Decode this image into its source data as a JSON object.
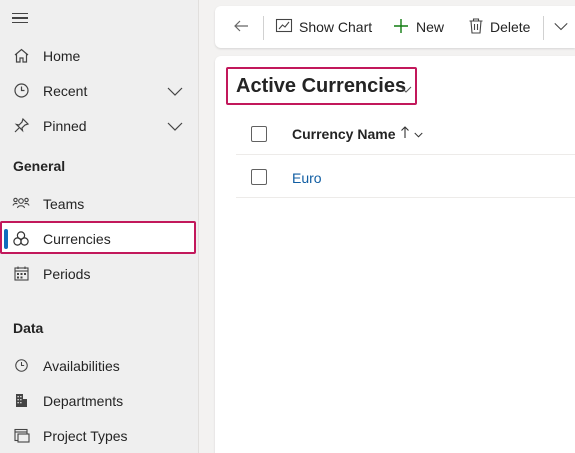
{
  "sidebar": {
    "menu_icon": "hamburger-icon",
    "items": [
      {
        "label": "Home",
        "icon": "home-icon"
      },
      {
        "label": "Recent",
        "icon": "clock-icon"
      },
      {
        "label": "Pinned",
        "icon": "pin-icon"
      }
    ],
    "sections": [
      {
        "title": "General",
        "items": [
          {
            "label": "Teams",
            "icon": "people-icon"
          },
          {
            "label": "Currencies",
            "icon": "currency-icon",
            "selected": true
          },
          {
            "label": "Periods",
            "icon": "calendar-icon"
          }
        ]
      },
      {
        "title": "Data",
        "items": [
          {
            "label": "Availabilities",
            "icon": "clock-icon"
          },
          {
            "label": "Departments",
            "icon": "building-icon"
          },
          {
            "label": "Project Types",
            "icon": "window-icon"
          }
        ]
      }
    ]
  },
  "commandbar": {
    "back_icon": "back-arrow-icon",
    "show_chart": "Show Chart",
    "new": "New",
    "delete": "Delete",
    "more_icon": "chevron-down-icon"
  },
  "view": {
    "title": "Active Currencies",
    "columns": [
      {
        "label": "Currency Name",
        "sort": "ascending"
      }
    ],
    "rows": [
      {
        "name": "Euro"
      }
    ]
  },
  "colors": {
    "accent": "#0f6cbd",
    "highlight_border": "#c2185b",
    "link": "#115ea3"
  }
}
